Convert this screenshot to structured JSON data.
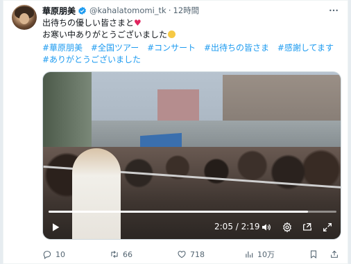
{
  "tweet": {
    "display_name": "華原朋美",
    "handle": "@kahalatomomi_tk",
    "separator": "·",
    "time": "12時間",
    "text_line1": "出待ちの優しい皆さまと",
    "text_line1_heart": "♥",
    "text_line2": "お寒い中ありがとうございました",
    "hashtags": [
      "#華原朋美",
      "#全国ツアー",
      "#コンサート",
      "#出待ちの皆さま",
      "#感謝してます",
      "#ありがとうございました"
    ]
  },
  "video": {
    "timecode": "2:05 / 2:19",
    "progress": 0.9
  },
  "actions": {
    "replies": "10",
    "retweets": "66",
    "likes": "718",
    "views": "10万"
  },
  "colors": {
    "link": "#1d9bf0",
    "muted": "#536471",
    "verified": "#1d9bf0",
    "heart": "#e0245e"
  },
  "icons": [
    "more-icon",
    "verified-badge-icon",
    "play-icon",
    "volume-icon",
    "settings-icon",
    "pip-icon",
    "fullscreen-icon",
    "reply-icon",
    "retweet-icon",
    "like-icon",
    "views-icon",
    "bookmark-icon",
    "share-icon"
  ]
}
